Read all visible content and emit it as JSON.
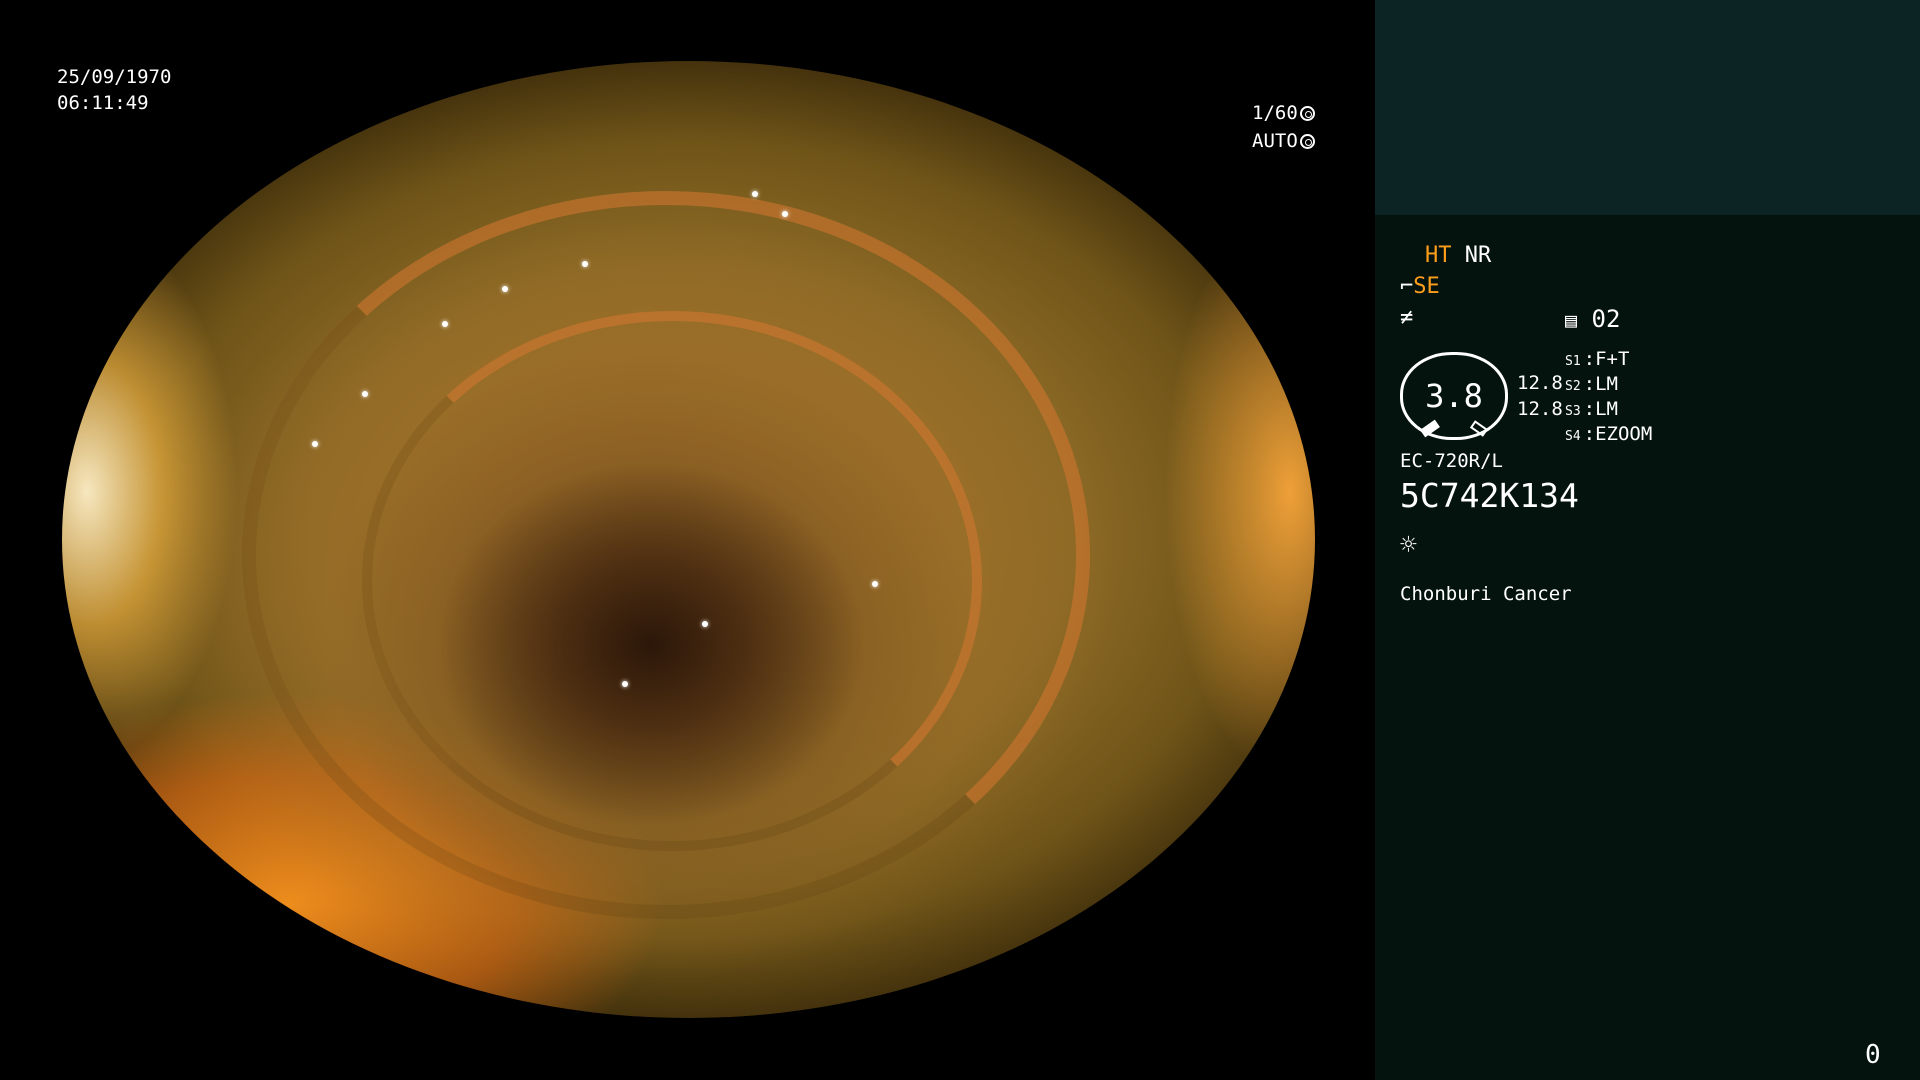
{
  "overlay": {
    "date": "25/09/1970",
    "time": "06:11:49",
    "shutter": "1/60",
    "iris_mode": "AUTO",
    "shutter_icon": "aperture-icon",
    "iris_icon": "iris-icon"
  },
  "panel": {
    "enhancement_ht": "HT",
    "enhancement_nr": "NR",
    "structure_enhancement": "SE",
    "program_icon": "menu-list-icon",
    "program_number": "02",
    "dial_value": "3.8",
    "dial_right_top": "12.8",
    "dial_right_bottom": "12.8",
    "switches": [
      {
        "key": "S1",
        "value": "F+T"
      },
      {
        "key": "S2",
        "value": "LM"
      },
      {
        "key": "S3",
        "value": "LM"
      },
      {
        "key": "S4",
        "value": "EZOOM"
      }
    ],
    "scope_model": "EC-720R/L",
    "scope_serial": "5C742K134",
    "light_icon": "sun-icon",
    "hospital": "Chonburi Cancer",
    "counter": "0"
  },
  "colors": {
    "accent_orange": "#ff9e1b",
    "panel_bg": "#05130f",
    "panel_top_bg": "#0c2424"
  }
}
